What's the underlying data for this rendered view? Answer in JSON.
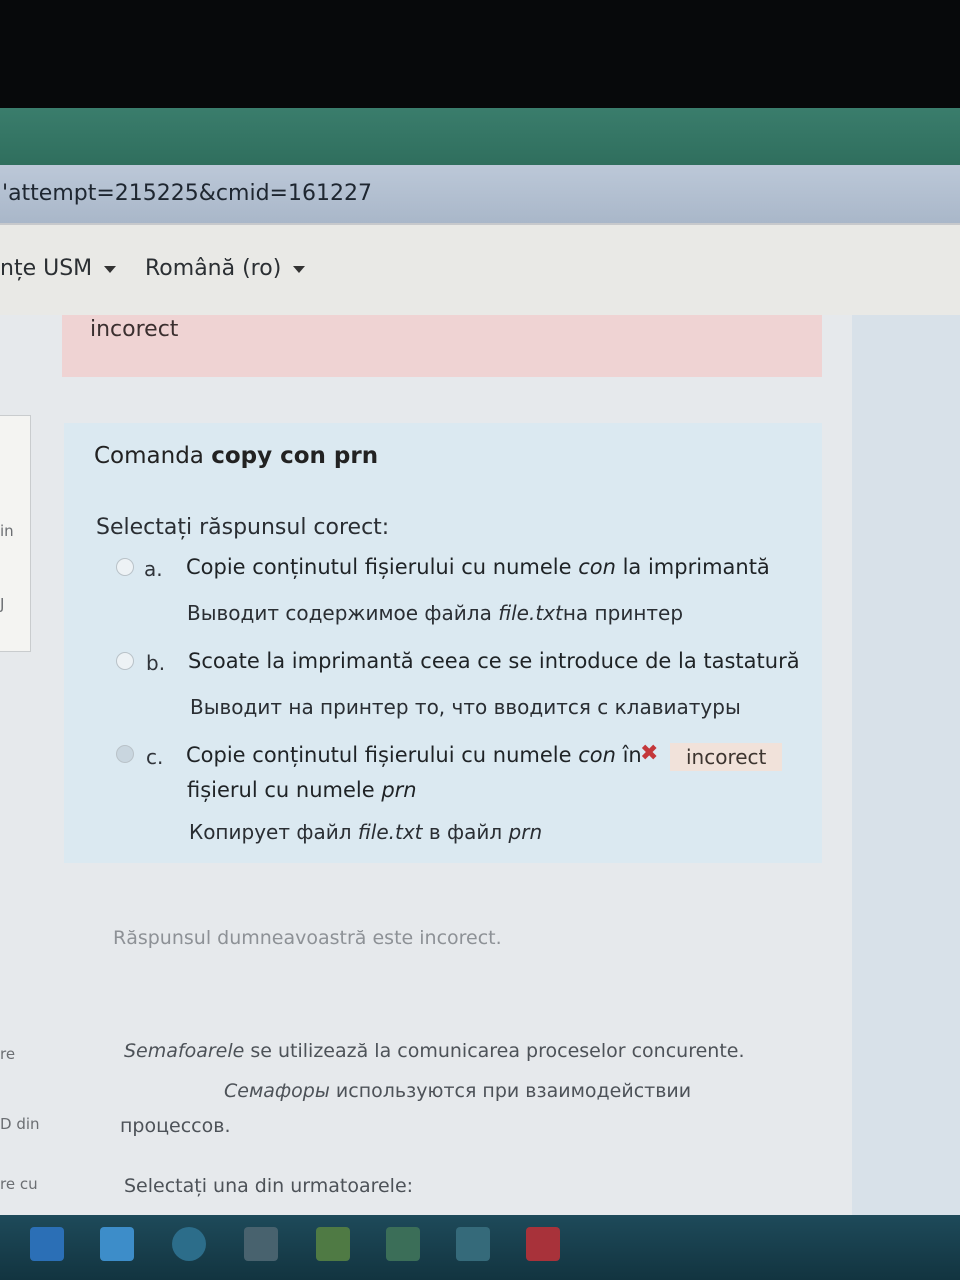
{
  "browser": {
    "url_fragment": "attempt=215225&cmid=161227"
  },
  "navbar": {
    "user_menu": "nțe USM",
    "language_menu": "Română (ro)"
  },
  "previous_feedback": {
    "text": "incorect"
  },
  "question": {
    "text_prefix": "Comanda ",
    "text_bold": "copy con prn",
    "prompt": "Selectați răspunsul corect:",
    "options": [
      {
        "letter": "a.",
        "text_before": "Copie conținutul fișierului cu numele ",
        "text_italic": "con",
        "text_after": " la imprimantă",
        "ru_before": "Выводит содержимое файла ",
        "ru_italic": "file.txt",
        "ru_after": "на принтер"
      },
      {
        "letter": "b.",
        "text": "Scoate la imprimantă ceea ce se introduce de la tastatură",
        "ru": "Выводит на принтер то, что вводится с клавиатуры"
      },
      {
        "letter": "c.",
        "text_before": "Copie conținutul fișierului cu numele ",
        "text_italic": "con",
        "text_after": " în",
        "line2_before": "fișierul cu numele ",
        "line2_italic": "prn",
        "ru_before": "Копирует файл ",
        "ru_italic": "file.txt",
        "ru_middle": " в файл ",
        "ru_italic2": "prn",
        "mark": "✖",
        "badge": "incorect"
      }
    ],
    "result": "Răspunsul dumneavoastră este incorect."
  },
  "next_question": {
    "ro_italic": "Semafoarele",
    "ro_rest": " se utilizează la comunicarea proceselor concurente.",
    "ru_italic": "Семафоры",
    "ru_rest": " используются при взаимодействии",
    "ru_line2": "процессов.",
    "prompt": "Selectați una din urmatoarele:"
  },
  "left_fragments": [
    "in",
    "J",
    "re",
    "D din",
    "re cu"
  ],
  "colors": {
    "feedback_bg": "#efd3d3",
    "question_bg": "#dbe9f1",
    "wrong_mark": "#c4373a"
  },
  "taskbar_icons": [
    "store-icon",
    "mail-icon",
    "skype-icon",
    "cube-icon",
    "chart-icon",
    "files-icon",
    "monitor-icon",
    "pdf-icon"
  ]
}
